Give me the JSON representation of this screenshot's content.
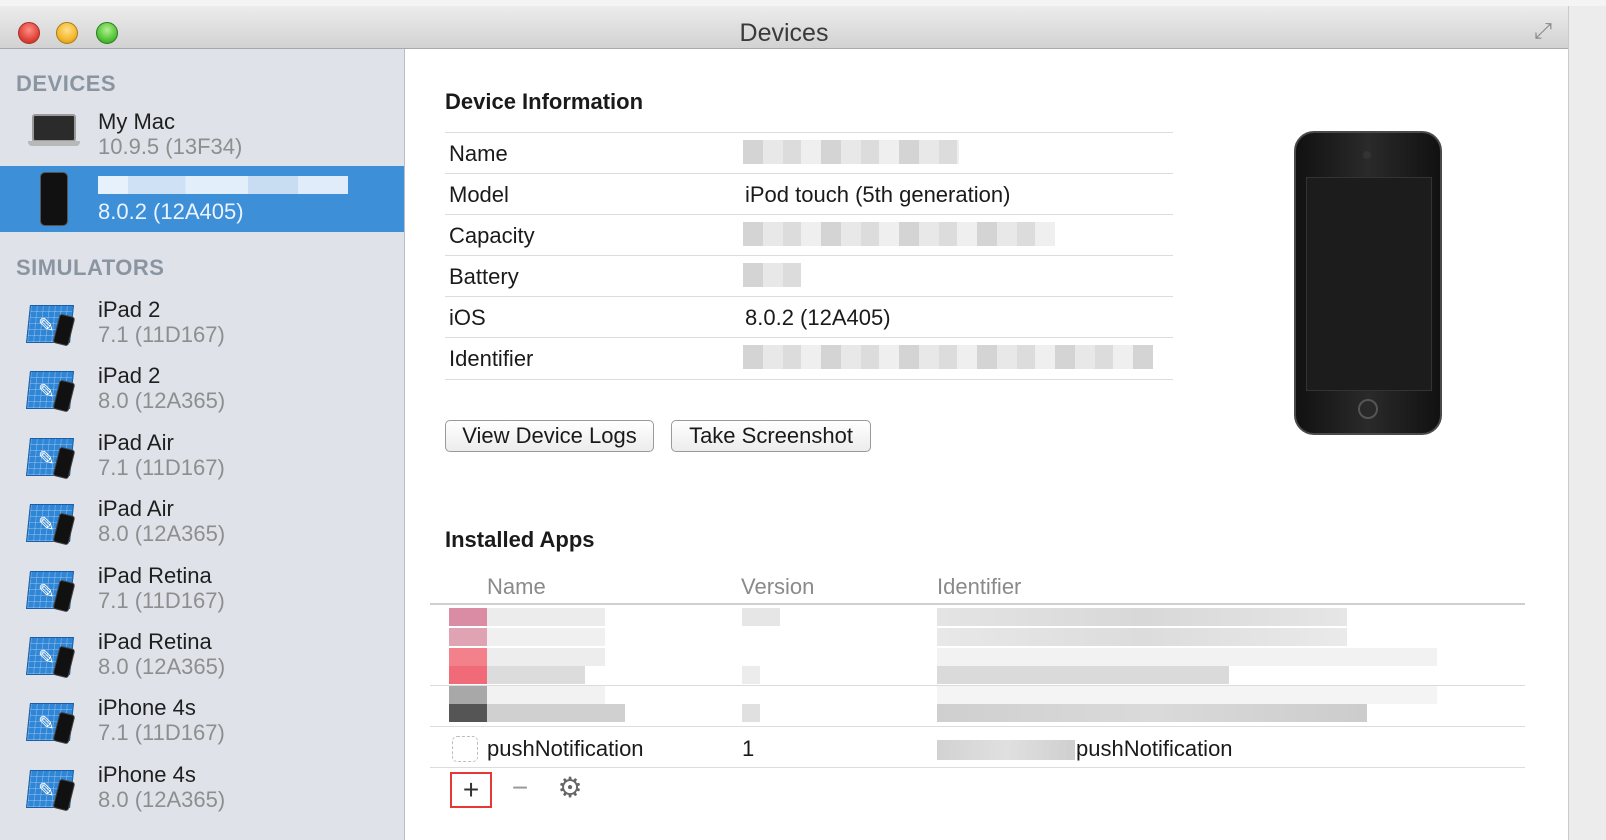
{
  "window": {
    "title": "Devices"
  },
  "sidebar": {
    "devices_header": "DEVICES",
    "simulators_header": "SIMULATORS",
    "devices": [
      {
        "name": "My Mac",
        "version": "10.9.5 (13F34)",
        "icon": "laptop-icon"
      },
      {
        "name": "",
        "version": "8.0.2 (12A405)",
        "icon": "ipod-icon",
        "selected": true
      }
    ],
    "simulators": [
      {
        "name": "iPad 2",
        "version": "7.1 (11D167)"
      },
      {
        "name": "iPad 2",
        "version": "8.0 (12A365)"
      },
      {
        "name": "iPad Air",
        "version": "7.1 (11D167)"
      },
      {
        "name": "iPad Air",
        "version": "8.0 (12A365)"
      },
      {
        "name": "iPad Retina",
        "version": "7.1 (11D167)"
      },
      {
        "name": "iPad Retina",
        "version": "8.0 (12A365)"
      },
      {
        "name": "iPhone 4s",
        "version": "7.1 (11D167)"
      },
      {
        "name": "iPhone 4s",
        "version": "8.0 (12A365)"
      }
    ]
  },
  "device_info": {
    "heading": "Device Information",
    "rows": [
      {
        "label": "Name",
        "value": ""
      },
      {
        "label": "Model",
        "value": "iPod touch (5th generation)"
      },
      {
        "label": "Capacity",
        "value": ""
      },
      {
        "label": "Battery",
        "value": ""
      },
      {
        "label": "iOS",
        "value": "8.0.2 (12A405)"
      },
      {
        "label": "Identifier",
        "value": ""
      }
    ],
    "buttons": {
      "logs": "View Device Logs",
      "screenshot": "Take Screenshot"
    }
  },
  "installed_apps": {
    "heading": "Installed Apps",
    "columns": {
      "name": "Name",
      "version": "Version",
      "identifier": "Identifier"
    },
    "app": {
      "name": "pushNotification",
      "version": "1",
      "identifier": "pushNotification"
    },
    "toolbar": {
      "add": "+",
      "remove": "−",
      "settings": "⚙"
    }
  },
  "colors": {
    "selection": "#3d8fd8",
    "sidebar_bg": "#dfe3e9",
    "highlight_box": "#e53935"
  }
}
